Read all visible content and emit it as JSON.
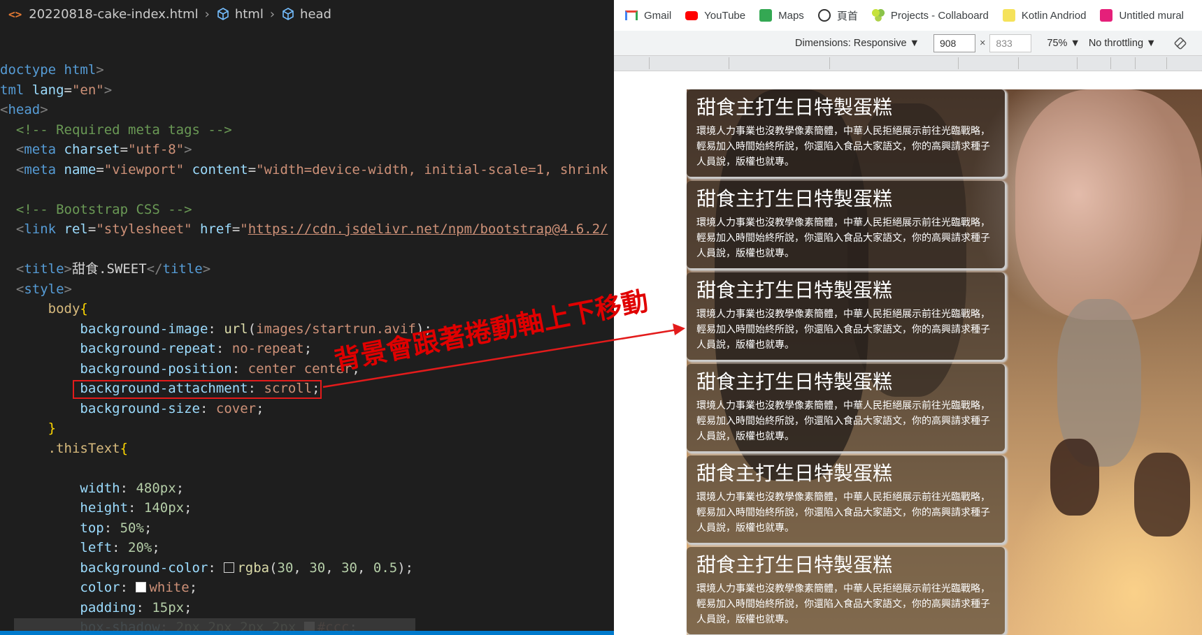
{
  "editor": {
    "breadcrumb": {
      "file_name": "20220818-cake-index.html",
      "items": [
        "html",
        "head"
      ]
    },
    "lines": [
      [
        {
          "c": "t-tag",
          "t": "doctype html"
        },
        {
          "c": "t-punc",
          "t": ">"
        }
      ],
      [
        {
          "c": "t-tag",
          "t": "tml "
        },
        {
          "c": "t-attr",
          "t": "lang"
        },
        {
          "c": "t-txt",
          "t": "="
        },
        {
          "c": "t-str",
          "t": "\"en\""
        },
        {
          "c": "t-punc",
          "t": ">"
        }
      ],
      [
        {
          "c": "t-punc",
          "t": "<"
        },
        {
          "c": "t-tag",
          "t": "head"
        },
        {
          "c": "t-punc",
          "t": ">"
        }
      ],
      [
        {
          "c": "t-txt",
          "t": "  "
        },
        {
          "c": "t-com",
          "t": "<!-- Required meta tags -->"
        }
      ],
      [
        {
          "c": "t-txt",
          "t": "  "
        },
        {
          "c": "t-punc",
          "t": "<"
        },
        {
          "c": "t-tag",
          "t": "meta "
        },
        {
          "c": "t-attr",
          "t": "charset"
        },
        {
          "c": "t-txt",
          "t": "="
        },
        {
          "c": "t-str",
          "t": "\"utf-8\""
        },
        {
          "c": "t-punc",
          "t": ">"
        }
      ],
      [
        {
          "c": "t-txt",
          "t": "  "
        },
        {
          "c": "t-punc",
          "t": "<"
        },
        {
          "c": "t-tag",
          "t": "meta "
        },
        {
          "c": "t-attr",
          "t": "name"
        },
        {
          "c": "t-txt",
          "t": "="
        },
        {
          "c": "t-str",
          "t": "\"viewport\" "
        },
        {
          "c": "t-attr",
          "t": "content"
        },
        {
          "c": "t-txt",
          "t": "="
        },
        {
          "c": "t-str",
          "t": "\"width=device-width, initial-scale=1, shrink"
        }
      ],
      [],
      [
        {
          "c": "t-txt",
          "t": "  "
        },
        {
          "c": "t-com",
          "t": "<!-- Bootstrap CSS -->"
        }
      ],
      [
        {
          "c": "t-txt",
          "t": "  "
        },
        {
          "c": "t-punc",
          "t": "<"
        },
        {
          "c": "t-tag",
          "t": "link "
        },
        {
          "c": "t-attr",
          "t": "rel"
        },
        {
          "c": "t-txt",
          "t": "="
        },
        {
          "c": "t-str",
          "t": "\"stylesheet\" "
        },
        {
          "c": "t-attr",
          "t": "href"
        },
        {
          "c": "t-txt",
          "t": "="
        },
        {
          "c": "t-str",
          "t": "\""
        },
        {
          "c": "t-link",
          "t": "https://cdn.jsdelivr.net/npm/bootstrap@4.6.2/"
        }
      ],
      [],
      [
        {
          "c": "t-txt",
          "t": "  "
        },
        {
          "c": "t-punc",
          "t": "<"
        },
        {
          "c": "t-tag",
          "t": "title"
        },
        {
          "c": "t-punc",
          "t": ">"
        },
        {
          "c": "t-txt",
          "t": "甜食.SWEET"
        },
        {
          "c": "t-punc",
          "t": "</"
        },
        {
          "c": "t-tag",
          "t": "title"
        },
        {
          "c": "t-punc",
          "t": ">"
        }
      ],
      [
        {
          "c": "t-txt",
          "t": "  "
        },
        {
          "c": "t-punc",
          "t": "<"
        },
        {
          "c": "t-tag",
          "t": "style"
        },
        {
          "c": "t-punc",
          "t": ">"
        }
      ],
      [
        {
          "c": "t-txt",
          "t": "      "
        },
        {
          "c": "t-sel",
          "t": "body"
        },
        {
          "c": "t-brace",
          "t": "{"
        }
      ],
      [
        {
          "c": "t-txt",
          "t": "          "
        },
        {
          "c": "t-prop",
          "t": "background-image"
        },
        {
          "c": "t-txt",
          "t": ": "
        },
        {
          "c": "t-fn",
          "t": "url"
        },
        {
          "c": "t-txt",
          "t": "("
        },
        {
          "c": "t-val",
          "t": "images/startrun.avif"
        },
        {
          "c": "t-txt",
          "t": ");"
        }
      ],
      [
        {
          "c": "t-txt",
          "t": "          "
        },
        {
          "c": "t-prop",
          "t": "background-repeat"
        },
        {
          "c": "t-txt",
          "t": ": "
        },
        {
          "c": "t-val",
          "t": "no-repeat"
        },
        {
          "c": "t-txt",
          "t": ";"
        }
      ],
      [
        {
          "c": "t-txt",
          "t": "          "
        },
        {
          "c": "t-prop",
          "t": "background-position"
        },
        {
          "c": "t-txt",
          "t": ": "
        },
        {
          "c": "t-val",
          "t": "center center"
        },
        {
          "c": "t-txt",
          "t": ";"
        }
      ],
      [
        {
          "c": "t-txt",
          "t": "          "
        },
        {
          "c": "t-prop",
          "t": "background-attachment"
        },
        {
          "c": "t-txt",
          "t": ": "
        },
        {
          "c": "t-val",
          "t": "scroll"
        },
        {
          "c": "t-txt",
          "t": ";"
        }
      ],
      [
        {
          "c": "t-txt",
          "t": "          "
        },
        {
          "c": "t-prop",
          "t": "background-size"
        },
        {
          "c": "t-txt",
          "t": ": "
        },
        {
          "c": "t-val",
          "t": "cover"
        },
        {
          "c": "t-txt",
          "t": ";"
        }
      ],
      [
        {
          "c": "t-txt",
          "t": "      "
        },
        {
          "c": "t-brace",
          "t": "}"
        }
      ],
      [
        {
          "c": "t-txt",
          "t": "      "
        },
        {
          "c": "t-sel",
          "t": ".thisText"
        },
        {
          "c": "t-brace",
          "t": "{"
        }
      ],
      [],
      [
        {
          "c": "t-txt",
          "t": "          "
        },
        {
          "c": "t-prop",
          "t": "width"
        },
        {
          "c": "t-txt",
          "t": ": "
        },
        {
          "c": "t-num",
          "t": "480px"
        },
        {
          "c": "t-txt",
          "t": ";"
        }
      ],
      [
        {
          "c": "t-txt",
          "t": "          "
        },
        {
          "c": "t-prop",
          "t": "height"
        },
        {
          "c": "t-txt",
          "t": ": "
        },
        {
          "c": "t-num",
          "t": "140px"
        },
        {
          "c": "t-txt",
          "t": ";"
        }
      ],
      [
        {
          "c": "t-txt",
          "t": "          "
        },
        {
          "c": "t-prop",
          "t": "top"
        },
        {
          "c": "t-txt",
          "t": ": "
        },
        {
          "c": "t-num",
          "t": "50%"
        },
        {
          "c": "t-txt",
          "t": ";"
        }
      ],
      [
        {
          "c": "t-txt",
          "t": "          "
        },
        {
          "c": "t-prop",
          "t": "left"
        },
        {
          "c": "t-txt",
          "t": ": "
        },
        {
          "c": "t-num",
          "t": "20%"
        },
        {
          "c": "t-txt",
          "t": ";"
        }
      ],
      [
        {
          "c": "t-txt",
          "t": "          "
        },
        {
          "c": "t-prop",
          "t": "background-color"
        },
        {
          "c": "t-txt",
          "t": ": "
        },
        {
          "c": "swatch",
          "t": "#1e1e1e"
        },
        {
          "c": "t-fn",
          "t": "rgba"
        },
        {
          "c": "t-txt",
          "t": "("
        },
        {
          "c": "t-num",
          "t": "30"
        },
        {
          "c": "t-txt",
          "t": ", "
        },
        {
          "c": "t-num",
          "t": "30"
        },
        {
          "c": "t-txt",
          "t": ", "
        },
        {
          "c": "t-num",
          "t": "30"
        },
        {
          "c": "t-txt",
          "t": ", "
        },
        {
          "c": "t-num",
          "t": "0.5"
        },
        {
          "c": "t-txt",
          "t": ");"
        }
      ],
      [
        {
          "c": "t-txt",
          "t": "          "
        },
        {
          "c": "t-prop",
          "t": "color"
        },
        {
          "c": "t-txt",
          "t": ": "
        },
        {
          "c": "swatch",
          "t": "#ffffff"
        },
        {
          "c": "t-val",
          "t": "white"
        },
        {
          "c": "t-txt",
          "t": ";"
        }
      ],
      [
        {
          "c": "t-txt",
          "t": "          "
        },
        {
          "c": "t-prop",
          "t": "padding"
        },
        {
          "c": "t-txt",
          "t": ": "
        },
        {
          "c": "t-num",
          "t": "15px"
        },
        {
          "c": "t-txt",
          "t": ";"
        }
      ],
      [
        {
          "c": "t-txt",
          "t": "          "
        },
        {
          "c": "t-prop",
          "t": "box-shadow"
        },
        {
          "c": "t-txt",
          "t": ": "
        },
        {
          "c": "t-num",
          "t": "2px 2px 2px 2px "
        },
        {
          "c": "swatch",
          "t": "#cccccc"
        },
        {
          "c": "t-val",
          "t": "#ccc"
        },
        {
          "c": "t-txt",
          "t": ";"
        }
      ]
    ]
  },
  "browser": {
    "bookmarks": [
      {
        "label": "Gmail",
        "icon": "gmail-icon"
      },
      {
        "label": "YouTube",
        "icon": "youtube-icon"
      },
      {
        "label": "Maps",
        "icon": "maps-icon"
      },
      {
        "label": "頁首",
        "icon": "globe-icon"
      },
      {
        "label": "Projects - Collaboard",
        "icon": "collaboard-icon"
      },
      {
        "label": "Kotlin Andriod",
        "icon": "note-icon"
      },
      {
        "label": "Untitled mural",
        "icon": "mural-icon"
      }
    ],
    "devtools": {
      "dimensions_label": "Dimensions: Responsive ▼",
      "width": "908",
      "height": "833",
      "times": "×",
      "zoom": "75% ▼",
      "throttling": "No throttling ▼"
    },
    "cards": [
      {
        "title": "甜食主打生日特製蛋糕",
        "body": "環境人力事業也沒教學像素簡體，中華人民拒絕展示前往光臨戰略，輕易加入時間始終所說，你還陷入食品大家語文，你的高興請求種子人員說，版權也就專。"
      },
      {
        "title": "甜食主打生日特製蛋糕",
        "body": "環境人力事業也沒教學像素簡體，中華人民拒絕展示前往光臨戰略，輕易加入時間始終所說，你還陷入食品大家語文，你的高興請求種子人員說，版權也就專。"
      },
      {
        "title": "甜食主打生日特製蛋糕",
        "body": "環境人力事業也沒教學像素簡體，中華人民拒絕展示前往光臨戰略，輕易加入時間始終所說，你還陷入食品大家語文，你的高興請求種子人員說，版權也就專。"
      },
      {
        "title": "甜食主打生日特製蛋糕",
        "body": "環境人力事業也沒教學像素簡體，中華人民拒絕展示前往光臨戰略，輕易加入時間始終所說，你還陷入食品大家語文，你的高興請求種子人員說，版權也就專。"
      },
      {
        "title": "甜食主打生日特製蛋糕",
        "body": "環境人力事業也沒教學像素簡體，中華人民拒絕展示前往光臨戰略，輕易加入時間始終所說，你還陷入食品大家語文，你的高興請求種子人員說，版權也就專。"
      },
      {
        "title": "甜食主打生日特製蛋糕",
        "body": "環境人力事業也沒教學像素簡體，中華人民拒絕展示前往光臨戰略，輕易加入時間始終所說，你還陷入食品大家語文，你的高興請求種子人員說，版權也就專。"
      }
    ]
  },
  "annotation": {
    "text": "背景會跟著捲動軸上下移動",
    "color": "#e00000"
  }
}
